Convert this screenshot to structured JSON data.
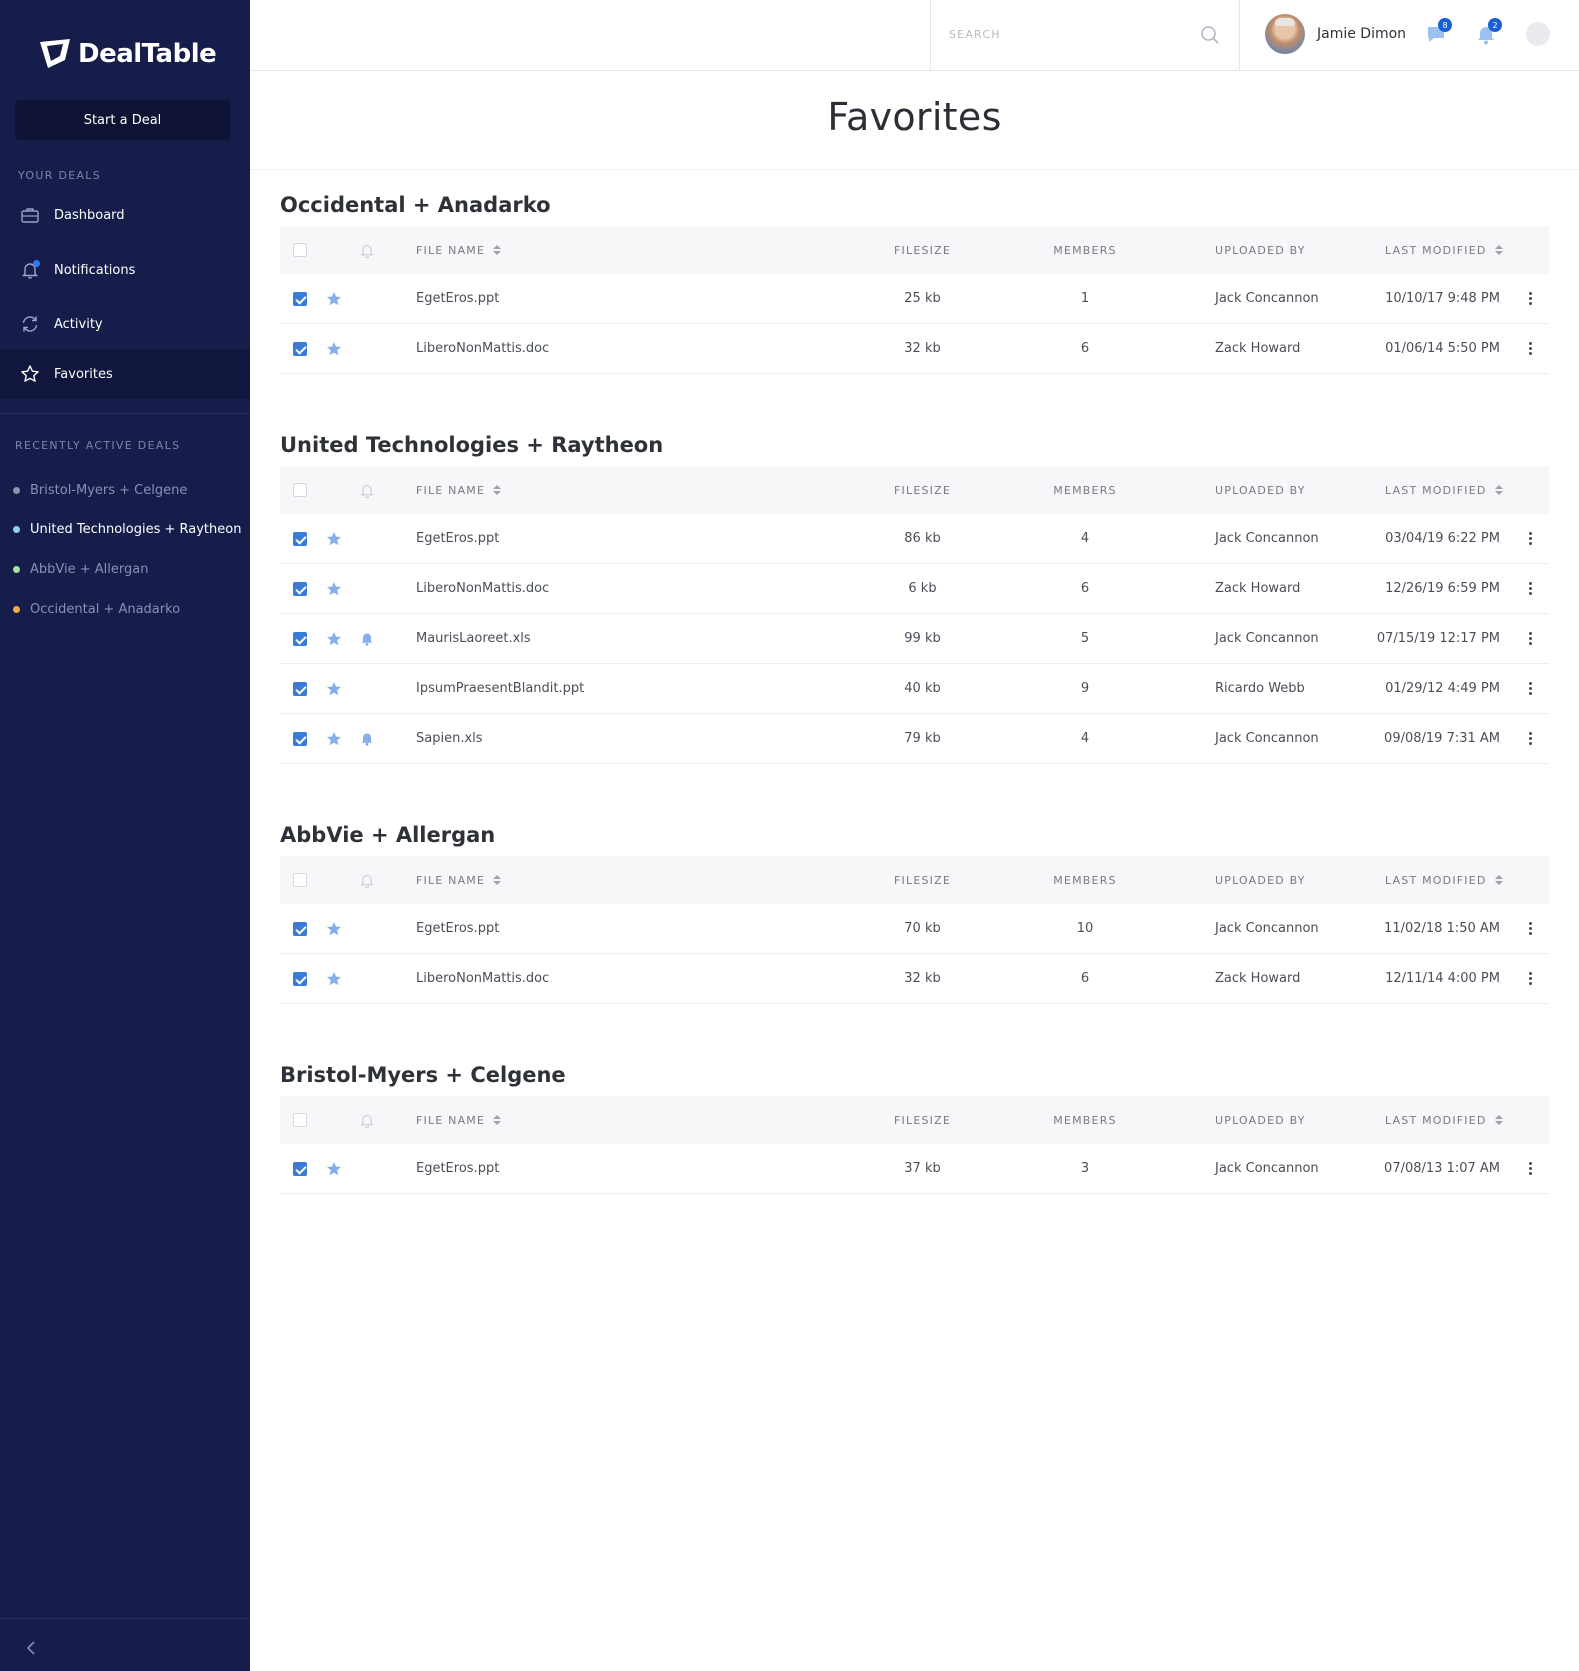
{
  "app": {
    "logo_text": "DealTable",
    "start_deal_label": "Start a Deal"
  },
  "sidebar": {
    "your_deals_label": "YOUR DEALS",
    "nav": [
      {
        "label": "Dashboard",
        "icon": "briefcase-icon"
      },
      {
        "label": "Notifications",
        "icon": "bell-icon"
      },
      {
        "label": "Activity",
        "icon": "refresh-icon"
      },
      {
        "label": "Favorites",
        "icon": "star-icon",
        "active": true
      }
    ],
    "recent_label": "RECENTLY ACTIVE DEALS",
    "recent": [
      {
        "label": "Bristol-Myers + Celgene",
        "color": "#8e94ab"
      },
      {
        "label": "United Technologies + Raytheon",
        "color": "#8fd3f4",
        "active": true
      },
      {
        "label": "AbbVie + Allergan",
        "color": "#a6e2a0"
      },
      {
        "label": "Occidental + Anadarko",
        "color": "#f5a84a"
      }
    ]
  },
  "header": {
    "search_placeholder": "SEARCH",
    "user_name": "Jamie Dimon",
    "messages_count": "8",
    "alerts_count": "2"
  },
  "page": {
    "title": "Favorites"
  },
  "columns": {
    "file_name": "FILE NAME",
    "filesize": "FILESIZE",
    "members": "MEMBERS",
    "uploaded_by": "UPLOADED BY",
    "last_modified": "LAST MODIFIED"
  },
  "deals": [
    {
      "title": "Occidental + Anadarko",
      "rows": [
        {
          "name": "EgetEros.ppt",
          "size": "25 kb",
          "members": "1",
          "uploader": "Jack Concannon",
          "modified": "10/10/17 9:48 PM",
          "bell": false
        },
        {
          "name": "LiberoNonMattis.doc",
          "size": "32 kb",
          "members": "6",
          "uploader": "Zack Howard",
          "modified": "01/06/14 5:50 PM",
          "bell": false
        }
      ]
    },
    {
      "title": "United Technologies + Raytheon",
      "rows": [
        {
          "name": "EgetEros.ppt",
          "size": "86 kb",
          "members": "4",
          "uploader": "Jack Concannon",
          "modified": "03/04/19 6:22 PM",
          "bell": false
        },
        {
          "name": "LiberoNonMattis.doc",
          "size": "6 kb",
          "members": "6",
          "uploader": "Zack Howard",
          "modified": "12/26/19 6:59 PM",
          "bell": false
        },
        {
          "name": "MaurisLaoreet.xls",
          "size": "99 kb",
          "members": "5",
          "uploader": "Jack Concannon",
          "modified": "07/15/19 12:17 PM",
          "bell": true
        },
        {
          "name": "IpsumPraesentBlandit.ppt",
          "size": "40 kb",
          "members": "9",
          "uploader": "Ricardo Webb",
          "modified": "01/29/12 4:49 PM",
          "bell": false
        },
        {
          "name": "Sapien.xls",
          "size": "79 kb",
          "members": "4",
          "uploader": "Jack Concannon",
          "modified": "09/08/19 7:31 AM",
          "bell": true
        }
      ]
    },
    {
      "title": "AbbVie + Allergan",
      "rows": [
        {
          "name": "EgetEros.ppt",
          "size": "70 kb",
          "members": "10",
          "uploader": "Jack Concannon",
          "modified": "11/02/18 1:50 AM",
          "bell": false
        },
        {
          "name": "LiberoNonMattis.doc",
          "size": "32 kb",
          "members": "6",
          "uploader": "Zack Howard",
          "modified": "12/11/14 4:00 PM",
          "bell": false
        }
      ]
    },
    {
      "title": "Bristol-Myers + Celgene",
      "rows": [
        {
          "name": "EgetEros.ppt",
          "size": "37 kb",
          "members": "3",
          "uploader": "Jack Concannon",
          "modified": "07/08/13 1:07 AM",
          "bell": false
        }
      ]
    }
  ],
  "colors": {
    "sidebar_bg": "#161d4b",
    "accent": "#3a7bd5",
    "badge": "#1b5fd6"
  }
}
